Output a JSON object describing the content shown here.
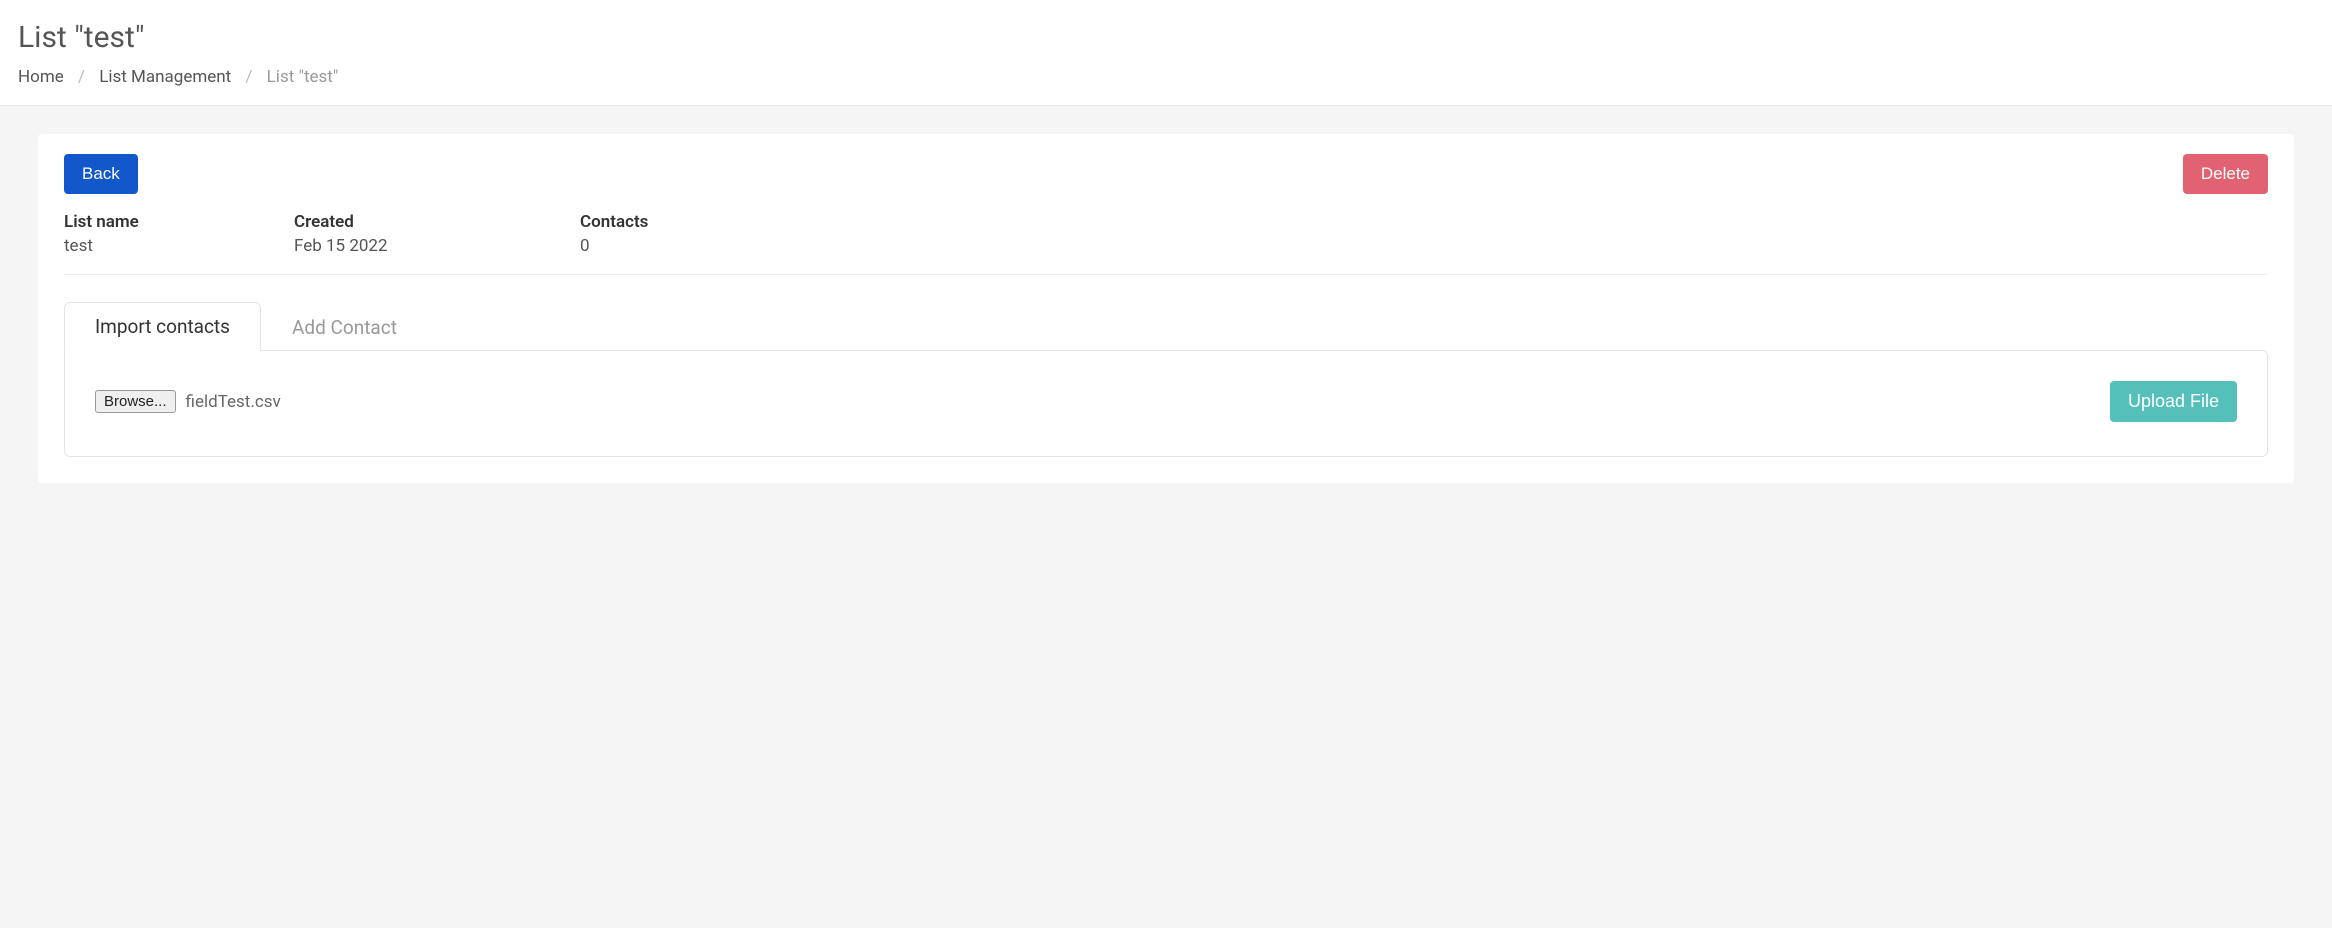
{
  "header": {
    "title": "List \"test\"",
    "breadcrumb": {
      "home": "Home",
      "list_management": "List Management",
      "current": "List \"test\""
    }
  },
  "actions": {
    "back_label": "Back",
    "delete_label": "Delete"
  },
  "meta": {
    "list_name_label": "List name",
    "list_name_value": "test",
    "created_label": "Created",
    "created_value": "Feb 15 2022",
    "contacts_label": "Contacts",
    "contacts_value": "0"
  },
  "tabs": {
    "import_label": "Import contacts",
    "add_contact_label": "Add Contact"
  },
  "import_panel": {
    "browse_label": "Browse...",
    "selected_file": "fieldTest.csv",
    "upload_label": "Upload File"
  }
}
